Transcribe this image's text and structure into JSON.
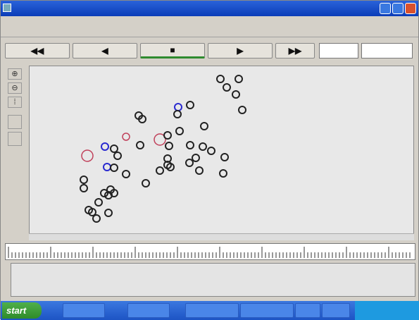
{
  "window": {
    "title": "",
    "icon": "app-window-icon"
  },
  "menu": {
    "items": [
      "",
      "",
      ""
    ],
    "title": ""
  },
  "controls": {
    "rewind": "◀◀",
    "back": "◀",
    "stop": "■",
    "play": "▶",
    "forward": "▶▶",
    "time": "",
    "step": ""
  },
  "sidebar": {
    "icons": [
      "zoom-in-icon",
      "zoom-out-icon",
      "layout-icon",
      "blank-button",
      "blank-button"
    ]
  },
  "network": {
    "node_labels": [
      "",
      "",
      "",
      ""
    ]
  },
  "console": {
    "lines": [
      "",
      "",
      ""
    ]
  },
  "taskbar": {
    "start_label": "start",
    "tasks": [
      "",
      "",
      "",
      "",
      "",
      ""
    ],
    "clock": ""
  },
  "colors": {
    "title_blue": "#0a3cb8",
    "node_black": "#222222",
    "node_blue": "#2a2ad0",
    "node_red": "#c0405a",
    "canvas_bg": "#e8e8e8"
  }
}
